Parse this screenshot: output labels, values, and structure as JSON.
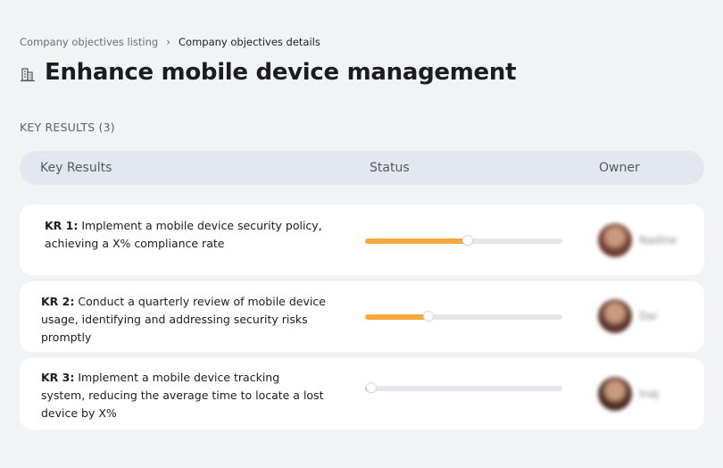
{
  "breadcrumb": {
    "parent": "Company objectives listing",
    "separator": "›",
    "current": "Company objectives details"
  },
  "page": {
    "title": "Enhance mobile device management",
    "icon": "building-icon"
  },
  "section": {
    "label": "KEY RESULTS (3)"
  },
  "table": {
    "columns": {
      "key_results": "Key Results",
      "status": "Status",
      "owner": "Owner"
    },
    "rows": [
      {
        "code": "KR 1:",
        "text": "Implement a mobile device security policy, achieving a X% compliance rate",
        "progress": 0.52,
        "owner": "Nadine",
        "avatar_color": "#6b3a2e"
      },
      {
        "code": "KR 2:",
        "text": "Conduct a quarterly review of mobile device usage, identifying and addressing security risks promptly",
        "progress": 0.32,
        "owner": "Dai",
        "avatar_color": "#5a3228"
      },
      {
        "code": "KR 3:",
        "text": "Implement a mobile device tracking system, reducing the average time to locate a lost device by X%",
        "progress": 0.03,
        "owner": "Inaj",
        "avatar_color": "#4a2a22"
      }
    ]
  },
  "colors": {
    "progress_fill": "#f7a93b",
    "progress_track": "#e6e7ea",
    "header_bg": "#e3e8f0",
    "page_bg": "#f2f3f5"
  }
}
